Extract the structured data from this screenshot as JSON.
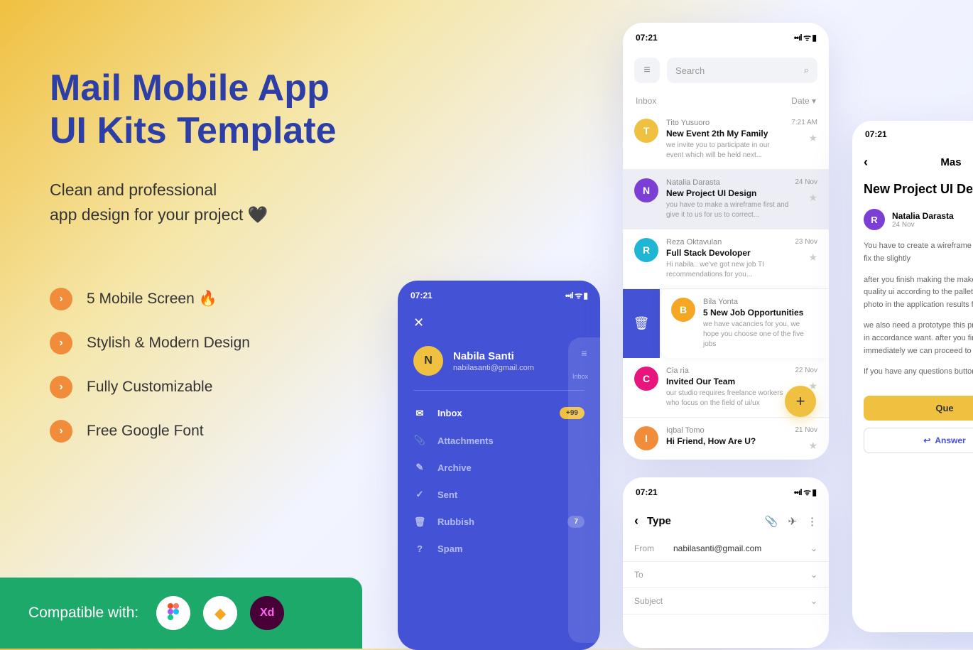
{
  "hero": {
    "title_line1": "Mail Mobile App",
    "title_line2": "UI Kits Template",
    "subtitle_line1": "Clean and professional",
    "subtitle_line2": "app design for your project 🖤"
  },
  "features": [
    "5 Mobile Screen 🔥",
    "Stylish & Modern Design",
    "Fully Customizable",
    "Free Google Font"
  ],
  "compat": {
    "label": "Compatible with:"
  },
  "statusbar": {
    "time": "07:21"
  },
  "sidebar": {
    "name": "Nabila Santi",
    "email": "nabilasanti@gmail.com",
    "items": [
      {
        "icon": "✉",
        "label": "Inbox",
        "badge": "+99",
        "active": true
      },
      {
        "icon": "📎",
        "label": "Attachments"
      },
      {
        "icon": "✎",
        "label": "Archive"
      },
      {
        "icon": "✓",
        "label": "Sent"
      },
      {
        "icon": "🗑",
        "label": "Rubbish",
        "badge": "7"
      },
      {
        "icon": "?",
        "label": "Spam"
      }
    ],
    "backdrop_label": "Inbox"
  },
  "inbox": {
    "search_placeholder": "Search",
    "header_left": "Inbox",
    "header_right": "Date ▾",
    "emails": [
      {
        "avatar": "T",
        "color": "av-yellow",
        "sender": "Tito Yusuoro",
        "subject": "New Event 2th My Family",
        "preview": "we invite you to participate in our event which will be held next...",
        "time": "7:21 AM"
      },
      {
        "avatar": "N",
        "color": "av-purple",
        "sender": "Natalia Darasta",
        "subject": "New Project UI Design",
        "preview": "you have to make a wireframe first and give it to us for us to correct...",
        "time": "24 Nov",
        "selected": true
      },
      {
        "avatar": "R",
        "color": "av-cyan",
        "sender": "Reza Oktavulan",
        "subject": "Full Stack Devoloper",
        "preview": "Hi nabila.. we've got new job TI recommendations for you...",
        "time": "23 Nov"
      },
      {
        "avatar": "B",
        "color": "av-orange",
        "sender": "Bila Yonta",
        "subject": "5 New Job Opportunities",
        "preview": "we have vacancies for you, we hope you choose one of the five jobs",
        "time": "",
        "swipe": true
      },
      {
        "avatar": "C",
        "color": "av-pink",
        "sender": "Cia ria",
        "subject": "Invited Our Team",
        "preview": "our studio requires freelance workers who focus on the field of ui/ux",
        "time": "22 Nov"
      },
      {
        "avatar": "I",
        "color": "av-iorange",
        "sender": "Iqbal Tomo",
        "subject": "Hi Friend, How Are U?",
        "preview": "",
        "time": "21 Nov"
      }
    ],
    "fab": "+"
  },
  "compose": {
    "title": "Type",
    "from_label": "From",
    "from_value": "nabilasanti@gmail.com",
    "to_label": "To",
    "subject_label": "Subject"
  },
  "detail": {
    "header_center": "Mas",
    "title": "New Project UI Design",
    "sender_name": "Natalia Darasta",
    "sender_date": "24 Nov",
    "body": [
      "You have to create a wireframe for us for us to fix the slightly",
      "after you finish making the make a hight quality ui according to the pallet the suitable photo in the application results from you.",
      "we also need a prototype this prototype to be in accordance want. after you finish it immediately we can proceed to the UX",
      "If you have any questions button below"
    ],
    "btn_question": "Que",
    "btn_answer": "Answer"
  }
}
